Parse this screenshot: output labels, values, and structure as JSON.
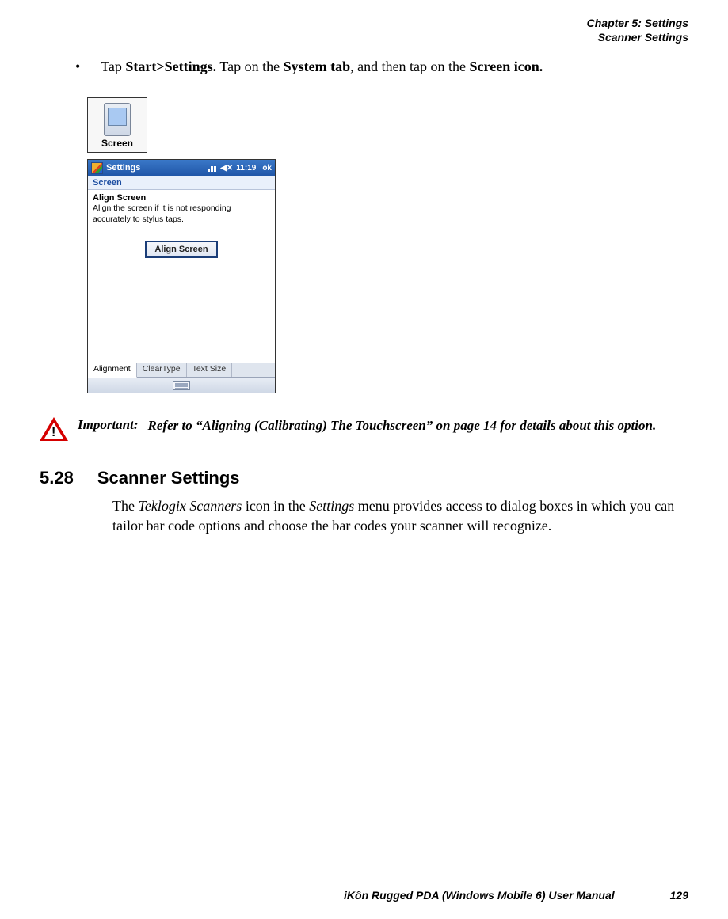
{
  "header": {
    "line1": "Chapter 5:  Settings",
    "line2": "Scanner Settings"
  },
  "instruction": {
    "bullet": "•",
    "pre": "Tap ",
    "b1": "Start>Settings.",
    "mid": " Tap on the ",
    "b2": "System tab",
    "mid2": ", and then tap on the ",
    "b3": "Screen icon."
  },
  "screenIcon": {
    "label": "Screen"
  },
  "screenshot": {
    "windowTitle": "Settings",
    "time": "11:19",
    "ok": "ok",
    "crumb": "Screen",
    "sectionTitle": "Align Screen",
    "sectionText": "Align the screen if it is not responding accurately to stylus taps.",
    "button": "Align Screen",
    "tabs": [
      "Alignment",
      "ClearType",
      "Text Size"
    ]
  },
  "important": {
    "label": "Important:",
    "text": "Refer to “Aligning (Calibrating) The Touchscreen” on page 14 for details about this option."
  },
  "section": {
    "number": "5.28",
    "title": "Scanner Settings",
    "para_pre": "The ",
    "para_i1": "Teklogix Scanners",
    "para_mid1": " icon in the ",
    "para_i2": "Settings",
    "para_tail": " menu provides access to dialog boxes in which you can tailor bar code options and choose the bar codes your scanner will recognize."
  },
  "footer": {
    "manual": "iKôn Rugged PDA (Windows Mobile 6) User Manual",
    "page": "129"
  }
}
